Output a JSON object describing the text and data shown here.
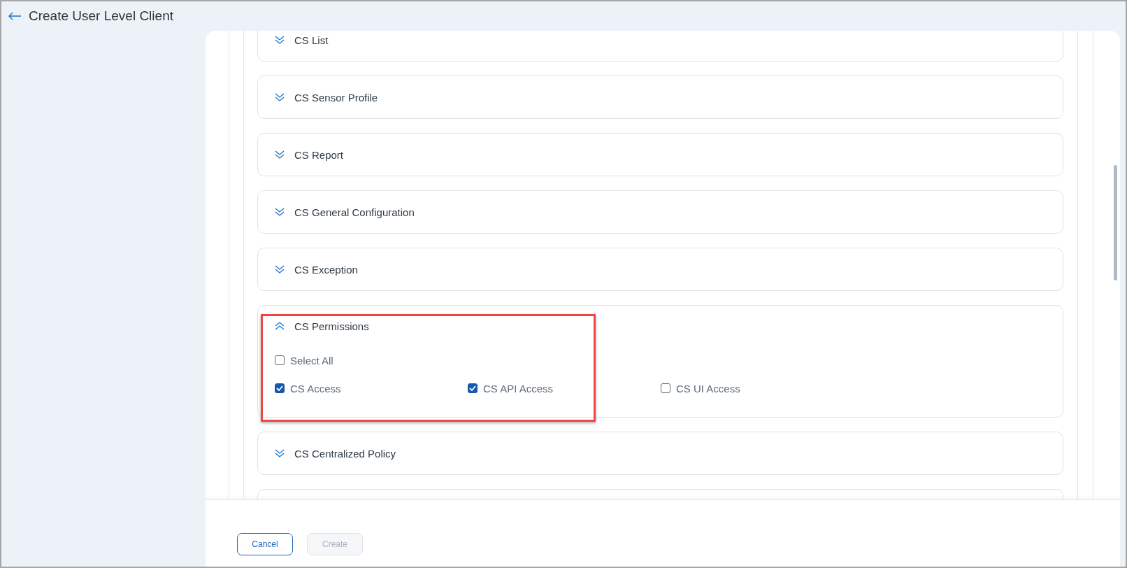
{
  "header": {
    "title": "Create User Level Client"
  },
  "sections": [
    {
      "title": "CS List",
      "expanded": false
    },
    {
      "title": "CS Sensor Profile",
      "expanded": false
    },
    {
      "title": "CS Report",
      "expanded": false
    },
    {
      "title": "CS General Configuration",
      "expanded": false
    },
    {
      "title": "CS Exception",
      "expanded": false
    },
    {
      "title": "CS Permissions",
      "expanded": true,
      "highlighted": true,
      "select_all": {
        "label": "Select All",
        "checked": false
      },
      "options": [
        {
          "label": "CS Access",
          "checked": true
        },
        {
          "label": "CS API Access",
          "checked": true
        },
        {
          "label": "CS UI Access",
          "checked": false
        }
      ]
    },
    {
      "title": "CS Centralized Policy",
      "expanded": false
    }
  ],
  "footer": {
    "buttons": [
      {
        "label": "Cancel",
        "disabled": false
      },
      {
        "label": "Create",
        "disabled": true
      }
    ]
  }
}
